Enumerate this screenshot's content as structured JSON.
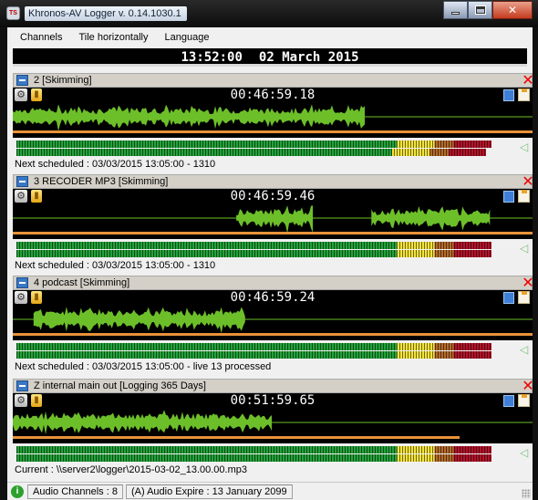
{
  "window": {
    "title": "Khronos-AV Logger  v. 0.14.1030.1",
    "app_icon": "logger-app-icon",
    "controls": [
      "minimize",
      "maximize",
      "close"
    ]
  },
  "menu": [
    {
      "label": "Channels"
    },
    {
      "label": "Tile horizontally"
    },
    {
      "label": "Language"
    }
  ],
  "clock": {
    "time": "13:52:00",
    "date": "02 March 2015"
  },
  "colors": {
    "waveform": "#6dbf2a",
    "progress": "#e8923a",
    "close": "#e00000",
    "vu_green": "#23a33a",
    "vu_yellow": "#f4e33b",
    "vu_red": "#b3132a"
  },
  "channels": [
    {
      "name": "2 [Skimming]",
      "time": "00:46:59.18",
      "status": "Next scheduled : 03/03/2015 13:05:00 - 1310",
      "progress": 1.0,
      "vu_left": 0.95,
      "vu_right": 0.94,
      "wave": [
        [
          0.0,
          0.68
        ]
      ]
    },
    {
      "name": "3 RECODER MP3 [Skimming]",
      "time": "00:46:59.46",
      "status": "Next scheduled : 03/03/2015 13:05:00 - 1310",
      "progress": 1.0,
      "vu_left": 0.95,
      "vu_right": 0.95,
      "wave": [
        [
          0.43,
          0.58
        ],
        [
          0.69,
          0.92
        ]
      ]
    },
    {
      "name": "4 podcast [Skimming]",
      "time": "00:46:59.24",
      "status": "Next scheduled : 03/03/2015 13:05:00 - live 13 processed",
      "progress": 1.0,
      "vu_left": 0.95,
      "vu_right": 0.95,
      "wave": [
        [
          0.04,
          0.45
        ]
      ]
    },
    {
      "name": "Z internal main out [Logging  365 Days]",
      "time": "00:51:59.65",
      "status": "Current : \\\\server2\\logger\\2015-03-02_13.00.00.mp3",
      "progress": 0.86,
      "vu_left": 0.95,
      "vu_right": 0.95,
      "wave": [
        [
          0.0,
          0.5
        ]
      ]
    }
  ],
  "statusbar": {
    "icon": "info-icon",
    "audio_channels": "Audio Channels : 8",
    "audio_expire": "(A) Audio Expire : 13 January 2099"
  }
}
